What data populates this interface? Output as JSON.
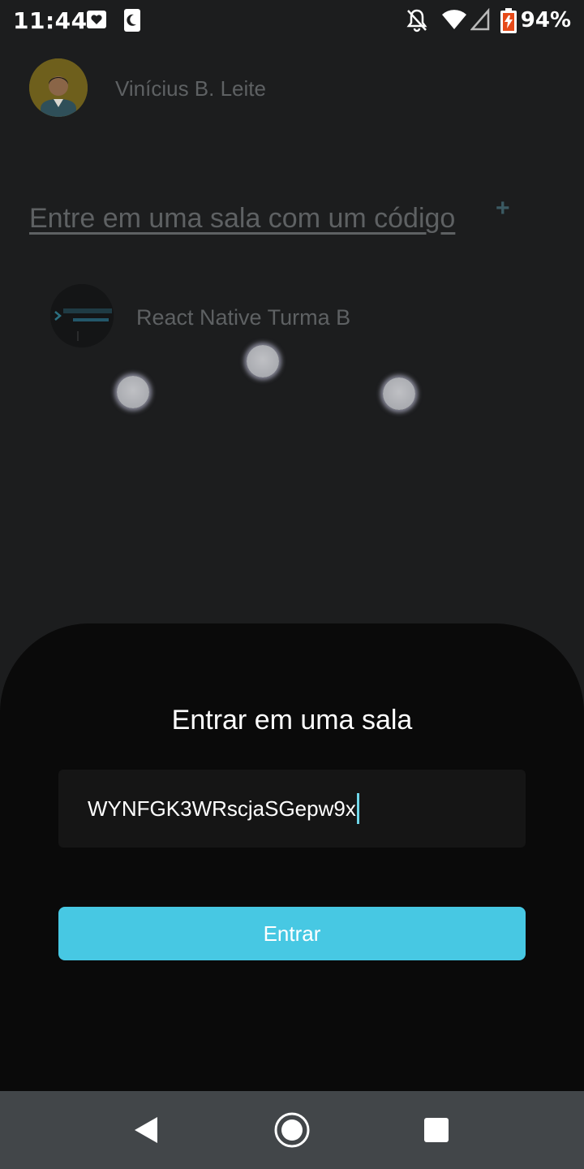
{
  "status_bar": {
    "time": "11:44",
    "battery_pct": "94%",
    "left_icons": [
      "heart-notification-icon",
      "moon-notification-icon"
    ],
    "right_icons": [
      "bell-off-icon",
      "wifi-icon",
      "cell-signal-icon",
      "battery-charging-icon"
    ]
  },
  "profile": {
    "name": "Vinícius B. Leite"
  },
  "join": {
    "link_label": "Entre em uma sala com um código",
    "plus_icon": "+"
  },
  "rooms": [
    {
      "name": "React Native Turma B"
    }
  ],
  "modal": {
    "title": "Entrar em uma sala",
    "code_value": "WYNFGK3WRscjaSGepw9x",
    "button_label": "Entrar"
  },
  "colors": {
    "accent": "#47c8e3",
    "sheet_bg": "#0a0a0a",
    "backdrop": "#1c1d1e",
    "nav_bg": "#424649"
  },
  "nav": {
    "buttons": [
      "back-icon",
      "home-icon",
      "recents-icon"
    ]
  }
}
